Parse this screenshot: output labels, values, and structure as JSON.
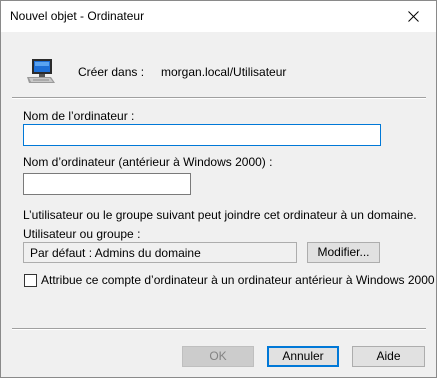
{
  "window": {
    "title": "Nouvel objet - Ordinateur",
    "close_glyph": "close-icon"
  },
  "header": {
    "icon": "computer-icon",
    "create_in_label": "Créer dans :",
    "create_in_path": "morgan.local/Utilisateur"
  },
  "form": {
    "computer_name_label": "Nom de l’ordinateur :",
    "computer_name_value": "",
    "pre2000_name_label": "Nom d’ordinateur (antérieur à Windows 2000) :",
    "pre2000_name_value": "",
    "join_info": "L’utilisateur ou le groupe suivant peut joindre cet ordinateur à un domaine.",
    "user_group_label": "Utilisateur ou groupe :",
    "user_group_value": "Par défaut : Admins du domaine",
    "modify_button": "Modifier...",
    "pre2000_checkbox_label": "Attribue ce compte d’ordinateur à un ordinateur antérieur à Windows 2000",
    "pre2000_checkbox_checked": false
  },
  "buttons": {
    "ok": "OK",
    "cancel": "Annuler",
    "help": "Aide"
  },
  "colors": {
    "focus_border": "#0078d7",
    "dialog_bg": "#f0f0f0"
  }
}
